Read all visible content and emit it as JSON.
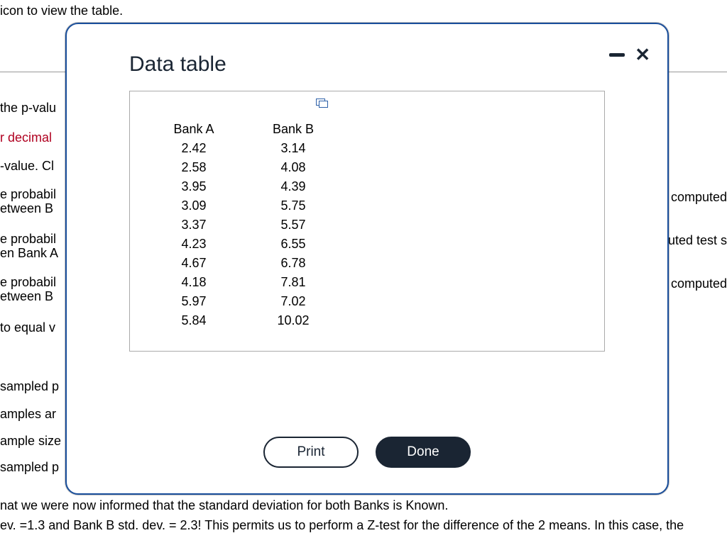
{
  "background": {
    "topLine": " icon to view the table.",
    "l1": "the p-valu",
    "l2": "r decimal",
    "l3": "-value. Cl",
    "l4": "e probabil",
    "l4b": "etween B",
    "l5": "e probabil",
    "l5b": "en Bank A",
    "l6": "e probabil",
    "l6b": "etween B",
    "l7": "to equal v",
    "l8": "sampled p",
    "l9": "amples ar",
    "l10": "ample size",
    "l11": "sampled p",
    "l12": "nat we were now informed  that the standard deviation for both Banks is Known.",
    "l13": "ev. =1.3  and Bank B std. dev. = 2.3!   This permits us to perform a Z-test for the difference of the 2 means.  In this case, the ",
    "r1": "computed",
    "r2": "uted test s",
    "r3": " computed"
  },
  "modal": {
    "title": "Data table",
    "print": "Print",
    "done": "Done"
  },
  "table": {
    "headers": [
      "Bank A",
      "Bank B"
    ],
    "rows": [
      [
        "2.42",
        "3.14"
      ],
      [
        "2.58",
        "4.08"
      ],
      [
        "3.95",
        "4.39"
      ],
      [
        "3.09",
        "5.75"
      ],
      [
        "3.37",
        "5.57"
      ],
      [
        "4.23",
        "6.55"
      ],
      [
        "4.67",
        "6.78"
      ],
      [
        "4.18",
        "7.81"
      ],
      [
        "5.97",
        "7.02"
      ],
      [
        "5.84",
        "10.02"
      ]
    ]
  },
  "chart_data": {
    "type": "table",
    "title": "Data table",
    "columns": [
      "Bank A",
      "Bank B"
    ],
    "series": [
      {
        "name": "Bank A",
        "values": [
          2.42,
          2.58,
          3.95,
          3.09,
          3.37,
          4.23,
          4.67,
          4.18,
          5.97,
          5.84
        ]
      },
      {
        "name": "Bank B",
        "values": [
          3.14,
          4.08,
          4.39,
          5.75,
          5.57,
          6.55,
          6.78,
          7.81,
          7.02,
          10.02
        ]
      }
    ]
  }
}
